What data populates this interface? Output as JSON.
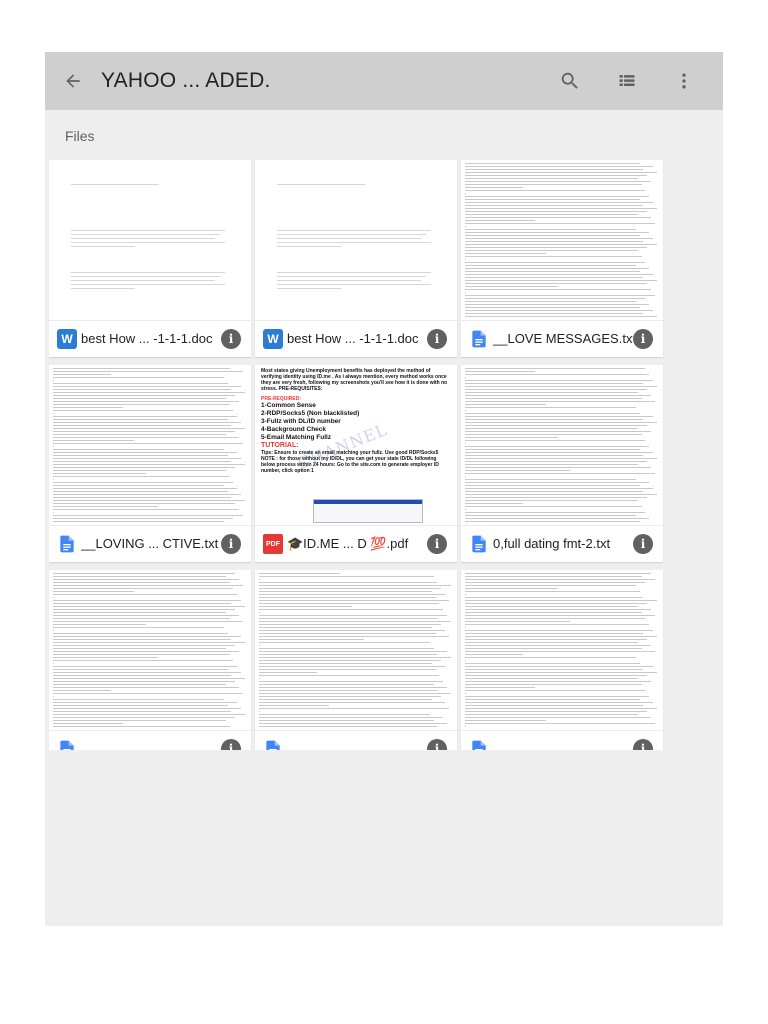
{
  "header": {
    "title": "YAHOO ... ADED.",
    "back_icon": "arrow-left-icon",
    "search_icon": "search-icon",
    "view_icon": "list-view-icon",
    "more_icon": "more-vert-icon"
  },
  "section_label": "Files",
  "colors": {
    "topbar": "#cfcfcf",
    "background": "#eeeeee",
    "word_blue": "#2b7cd3",
    "docs_blue": "#4285f4",
    "pdf_red": "#e53935"
  },
  "files": [
    {
      "name": "best How ... -1-1-1.doc",
      "type": "word",
      "type_label": "W"
    },
    {
      "name": "best How ... -1-1-1.doc",
      "type": "word",
      "type_label": "W"
    },
    {
      "name": "__LOVE MESSAGES.txt",
      "type": "txt"
    },
    {
      "name": "__LOVING ... CTIVE.txt",
      "type": "txt"
    },
    {
      "name": "🎓ID.ME ... D 💯.pdf",
      "type": "pdf",
      "type_label": "PDF"
    },
    {
      "name": "0,full dating fmt-2.txt",
      "type": "txt"
    },
    {
      "name": "",
      "type": "txt"
    },
    {
      "name": "",
      "type": "txt"
    },
    {
      "name": "",
      "type": "txt"
    }
  ],
  "info_glyph": "i",
  "pdf_preview": {
    "intro": "Most states giving Unemployment benefits has deployed the method of verifying identity using ID.me . As i always mention, every method works once they are very fresh, following my screenshots you'll see how it is done with no stress. PRE-REQUISITES:",
    "pre_label": "PRE-REQUIRED:",
    "items": [
      "1-Common Sense",
      "2-RDP/Socks5 (Non blacklisted)",
      "3-Fullz with DL/ID number",
      "4-Background Check",
      "5-Email Matching Fullz"
    ],
    "tutorial_label": "TUTORIAL:",
    "tips": "Tips: Ensure to create an email matching your fullz. Use good RDP/Socks5 NOTE : for those without my ID/DL, you can get your state ID/DL following below process within 24 hours: Go to the site.com to generate employer ID number, click option 1",
    "watermark": "CHANNEL"
  }
}
